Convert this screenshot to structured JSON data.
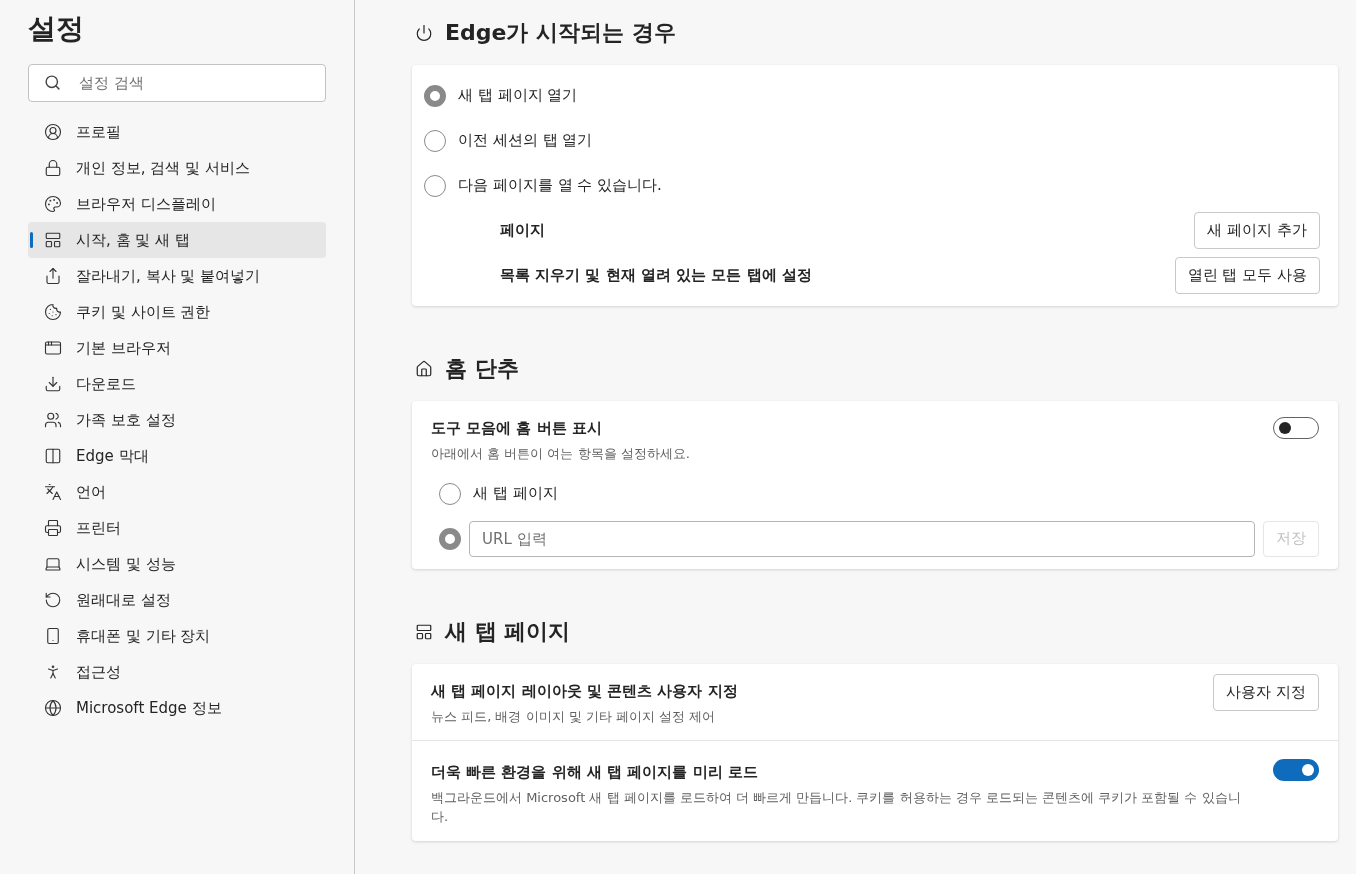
{
  "sidebar": {
    "title": "설정",
    "search": {
      "placeholder": "설정 검색"
    },
    "items": [
      {
        "label": "프로필",
        "selected": false
      },
      {
        "label": "개인 정보, 검색 및 서비스",
        "selected": false
      },
      {
        "label": "브라우저 디스플레이",
        "selected": false
      },
      {
        "label": "시작, 홈 및 새 탭",
        "selected": true
      },
      {
        "label": "잘라내기, 복사 및 붙여넣기",
        "selected": false
      },
      {
        "label": "쿠키 및 사이트 권한",
        "selected": false
      },
      {
        "label": "기본 브라우저",
        "selected": false
      },
      {
        "label": "다운로드",
        "selected": false
      },
      {
        "label": "가족 보호 설정",
        "selected": false
      },
      {
        "label": "Edge 막대",
        "selected": false
      },
      {
        "label": "언어",
        "selected": false
      },
      {
        "label": "프린터",
        "selected": false
      },
      {
        "label": "시스템 및 성능",
        "selected": false
      },
      {
        "label": "원래대로 설정",
        "selected": false
      },
      {
        "label": "휴대폰 및 기타 장치",
        "selected": false
      },
      {
        "label": "접근성",
        "selected": false
      },
      {
        "label": "Microsoft Edge 정보",
        "selected": false
      }
    ]
  },
  "sections": [
    {
      "kind": "startup",
      "title": "Edge가 시작되는 경우",
      "options": [
        {
          "label": "새 탭 페이지 열기",
          "selected": true
        },
        {
          "label": "이전 세션의 탭 열기",
          "selected": false
        },
        {
          "label": "다음 페이지를 열 수 있습니다.",
          "selected": false
        }
      ],
      "pages": [
        {
          "label": "페이지",
          "button": "새 페이지 추가"
        },
        {
          "label": "목록 지우기 및 현재 열려 있는 모든 탭에 설정",
          "button": "열린 탭 모두 사용"
        }
      ]
    },
    {
      "kind": "home",
      "title": "홈 단추",
      "toggle": {
        "label": "도구 모음에 홈 버튼 표시",
        "description": "아래에서 홈 버튼이 여는 항목을 설정하세요.",
        "on": false
      },
      "options": [
        {
          "kind": "plain",
          "label": "새 탭 페이지",
          "selected": false
        },
        {
          "kind": "url",
          "placeholder": "URL 입력",
          "selected": true,
          "button": "저장",
          "button_disabled": true
        }
      ]
    },
    {
      "kind": "newtab",
      "title": "새 탭 페이지",
      "rows": [
        {
          "kind": "button",
          "label": "새 탭 페이지 레이아웃 및 콘텐츠 사용자 지정",
          "description": "뉴스 피드, 배경 이미지 및 기타 페이지 설정 제어",
          "button": "사용자 지정"
        },
        {
          "kind": "toggle",
          "label": "더욱 빠른 환경을 위해 새 탭 페이지를 미리 로드",
          "description": "백그라운드에서 Microsoft 새 탭 페이지를 로드하여 더 빠르게 만듭니다. 쿠키를 허용하는 경우 로드되는 콘텐츠에 쿠키가 포함될 수 있습니다.",
          "on": true
        }
      ]
    }
  ]
}
